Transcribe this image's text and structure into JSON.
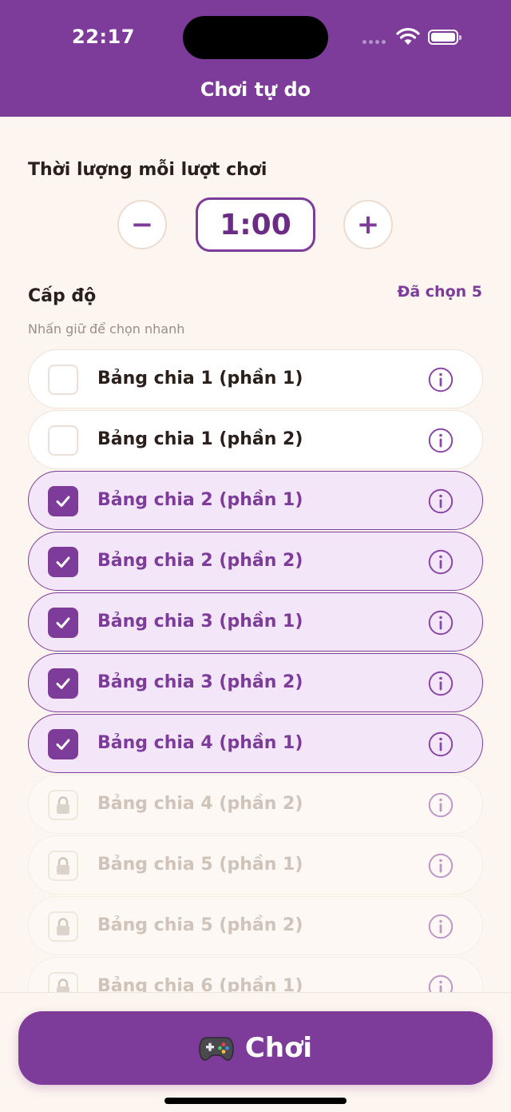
{
  "status": {
    "time": "22:17"
  },
  "nav": {
    "title": "Chơi tự do"
  },
  "duration": {
    "title": "Thời lượng mỗi lượt chơi",
    "value": "1:00",
    "minus": "−",
    "plus": "+"
  },
  "levels": {
    "title": "Cấp độ",
    "selected_text": "Đã chọn 5",
    "hint": "Nhấn giữ để chọn nhanh",
    "items": [
      {
        "label": "Bảng chia 1 (phần 1)",
        "state": "unchecked"
      },
      {
        "label": "Bảng chia 1 (phần 2)",
        "state": "unchecked"
      },
      {
        "label": "Bảng chia 2 (phần 1)",
        "state": "checked"
      },
      {
        "label": "Bảng chia 2 (phần 2)",
        "state": "checked"
      },
      {
        "label": "Bảng chia 3 (phần 1)",
        "state": "checked"
      },
      {
        "label": "Bảng chia 3 (phần 2)",
        "state": "checked"
      },
      {
        "label": "Bảng chia 4 (phần 1)",
        "state": "checked"
      },
      {
        "label": "Bảng chia 4 (phần 2)",
        "state": "locked"
      },
      {
        "label": "Bảng chia 5 (phần 1)",
        "state": "locked"
      },
      {
        "label": "Bảng chia 5 (phần 2)",
        "state": "locked"
      },
      {
        "label": "Bảng chia 6 (phần 1)",
        "state": "locked"
      }
    ]
  },
  "play": {
    "label": "Chơi",
    "icon": "gamepad-icon"
  },
  "colors": {
    "primary": "#7d3b9a",
    "background": "#fdf5ef",
    "selected_bg": "#f3e6f8"
  }
}
